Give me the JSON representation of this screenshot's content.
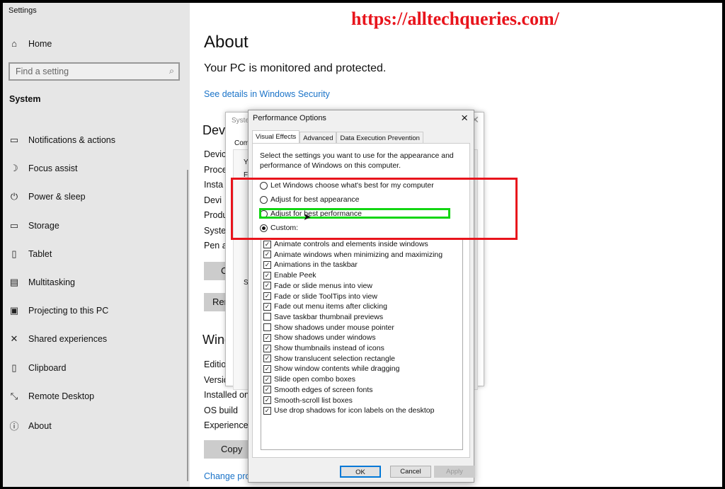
{
  "watermark": "https://alltechqueries.com/",
  "app_title": "Settings",
  "sidebar": {
    "home": {
      "label": "Home",
      "icon": "home-icon"
    },
    "search_placeholder": "Find a setting",
    "section": "System",
    "items": [
      {
        "label": "Notifications & actions",
        "icon": "notification-icon",
        "glyph": "▭"
      },
      {
        "label": "Focus assist",
        "icon": "moon-icon",
        "glyph": "☽"
      },
      {
        "label": "Power & sleep",
        "icon": "power-icon",
        "glyph": "⏻"
      },
      {
        "label": "Storage",
        "icon": "storage-icon",
        "glyph": "▭"
      },
      {
        "label": "Tablet",
        "icon": "tablet-icon",
        "glyph": "▯"
      },
      {
        "label": "Multitasking",
        "icon": "multitasking-icon",
        "glyph": "▤"
      },
      {
        "label": "Projecting to this PC",
        "icon": "projecting-icon",
        "glyph": "▣"
      },
      {
        "label": "Shared experiences",
        "icon": "shared-icon",
        "glyph": "✕"
      },
      {
        "label": "Clipboard",
        "icon": "clipboard-icon",
        "glyph": "▯"
      },
      {
        "label": "Remote Desktop",
        "icon": "remote-desktop-icon",
        "glyph": "⤡"
      },
      {
        "label": "About",
        "icon": "info-icon",
        "glyph": "ⓘ"
      }
    ]
  },
  "main": {
    "title": "About",
    "subtitle": "Your PC is monitored and protected.",
    "security_link": "See details in Windows Security",
    "device_heading": "Devic",
    "device_labels": [
      "Device",
      "Proces",
      "Insta",
      "Devi",
      "Produ",
      "System",
      "Pen an"
    ],
    "copy_button_1": "Co",
    "rename_button": "Rena",
    "windows_heading": "Wind",
    "windows_labels": [
      "Edition",
      "Versior",
      "Installed on",
      "OS build",
      "Experience"
    ],
    "copy_button_2": "Copy",
    "change_link": "Change pro"
  },
  "background_dialog": {
    "title": "Syste",
    "tab": "Com",
    "fragments": [
      "Y",
      "F",
      "S"
    ]
  },
  "performance_dialog": {
    "title": "Performance Options",
    "tabs": [
      "Visual Effects",
      "Advanced",
      "Data Execution Prevention"
    ],
    "active_tab": "Visual Effects",
    "description": "Select the settings you want to use for the appearance and performance of Windows on this computer.",
    "options": [
      {
        "label": "Let Windows choose what's best for my computer",
        "selected": false
      },
      {
        "label": "Adjust for best appearance",
        "selected": false
      },
      {
        "label": "Adjust for best performance",
        "selected": false
      },
      {
        "label": "Custom:",
        "selected": true
      }
    ],
    "effects": [
      {
        "label": "Animate controls and elements inside windows",
        "checked": true
      },
      {
        "label": "Animate windows when minimizing and maximizing",
        "checked": true
      },
      {
        "label": "Animations in the taskbar",
        "checked": true
      },
      {
        "label": "Enable Peek",
        "checked": true
      },
      {
        "label": "Fade or slide menus into view",
        "checked": true
      },
      {
        "label": "Fade or slide ToolTips into view",
        "checked": true
      },
      {
        "label": "Fade out menu items after clicking",
        "checked": true
      },
      {
        "label": "Save taskbar thumbnail previews",
        "checked": false
      },
      {
        "label": "Show shadows under mouse pointer",
        "checked": false
      },
      {
        "label": "Show shadows under windows",
        "checked": true
      },
      {
        "label": "Show thumbnails instead of icons",
        "checked": true
      },
      {
        "label": "Show translucent selection rectangle",
        "checked": true
      },
      {
        "label": "Show window contents while dragging",
        "checked": true
      },
      {
        "label": "Slide open combo boxes",
        "checked": true
      },
      {
        "label": "Smooth edges of screen fonts",
        "checked": true
      },
      {
        "label": "Smooth-scroll list boxes",
        "checked": true
      },
      {
        "label": "Use drop shadows for icon labels on the desktop",
        "checked": true
      }
    ],
    "buttons": {
      "ok": "OK",
      "cancel": "Cancel",
      "apply": "Apply"
    }
  },
  "colors": {
    "highlight_red": "#e8141c",
    "highlight_green": "#12d612",
    "link": "#1a73c8",
    "accent": "#0078d7"
  }
}
